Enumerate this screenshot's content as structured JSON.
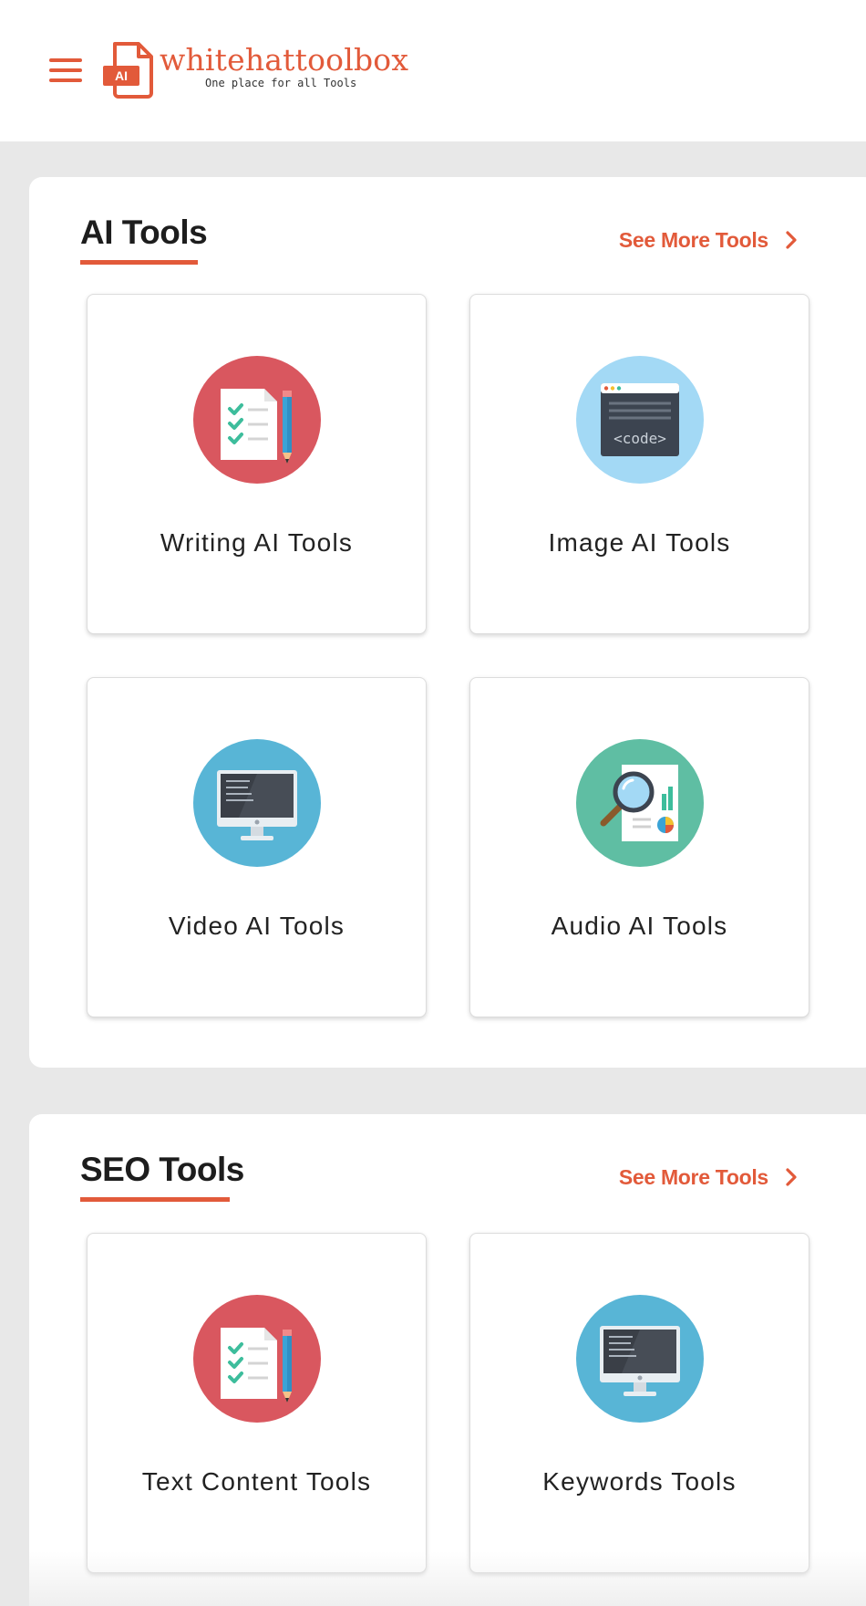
{
  "header": {
    "menu_icon": "hamburger-menu-icon",
    "logo_icon": "ai-document-logo-icon",
    "logo_badge": "AI",
    "brand_name": "whitehattoolbox",
    "tagline": "One place for all Tools"
  },
  "colors": {
    "accent": "#e25a3a",
    "page_bg": "#e8e8e8",
    "card_bg": "#ffffff",
    "red_circle": "#d9575f",
    "lightblue_circle": "#a3d9f5",
    "blue_circle": "#58b5d6",
    "green_circle": "#5fbea3"
  },
  "sections": [
    {
      "title": "AI Tools",
      "see_more": "See More Tools",
      "see_more_icon": "chevron-right-icon",
      "cards": [
        {
          "label": "Writing AI Tools",
          "icon": "checklist-pencil-icon"
        },
        {
          "label": "Image AI Tools",
          "icon": "code-window-icon"
        },
        {
          "label": "Video AI Tools",
          "icon": "monitor-code-icon"
        },
        {
          "label": "Audio AI Tools",
          "icon": "magnifier-report-icon"
        }
      ]
    },
    {
      "title": "SEO Tools",
      "see_more": "See More Tools",
      "see_more_icon": "chevron-right-icon",
      "cards": [
        {
          "label": "Text Content Tools",
          "icon": "checklist-pencil-icon"
        },
        {
          "label": "Keywords Tools",
          "icon": "monitor-code-icon"
        }
      ]
    }
  ]
}
